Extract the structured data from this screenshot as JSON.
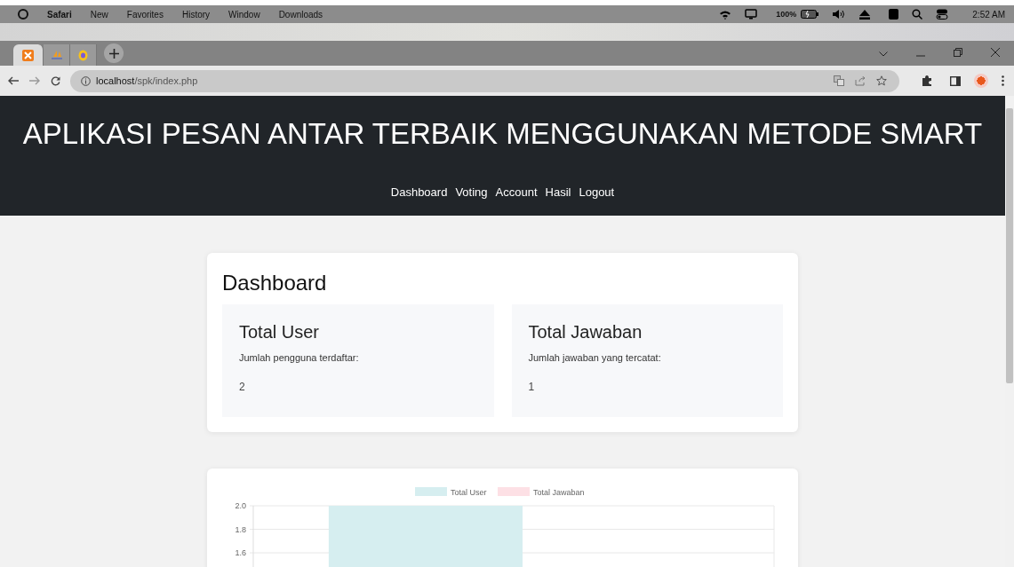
{
  "menubar": {
    "app": "Safari",
    "items": [
      "New",
      "Favorites",
      "History",
      "Window",
      "Downloads"
    ],
    "battery": "100%",
    "time": "2:52 AM"
  },
  "tabs": [
    {
      "kind": "xampp",
      "selected": true
    },
    {
      "kind": "pma",
      "selected": false
    },
    {
      "kind": "globe",
      "selected": false
    }
  ],
  "address": {
    "host": "localhost",
    "path": "/spk/index.php"
  },
  "header": {
    "title": "APLIKASI PESAN ANTAR TERBAIK MENGGUNAKAN METODE SMART",
    "nav": [
      "Dashboard",
      "Voting",
      "Account",
      "Hasil",
      "Logout"
    ]
  },
  "dashboard": {
    "title": "Dashboard",
    "stats": [
      {
        "title": "Total User",
        "subtitle": "Jumlah pengguna terdaftar:",
        "value": "2"
      },
      {
        "title": "Total Jawaban",
        "subtitle": "Jumlah jawaban yang tercatat:",
        "value": "1"
      }
    ]
  },
  "chart": {
    "chart_data": {
      "type": "bar",
      "categories": [
        null
      ],
      "legend": "top",
      "ylim": [
        0,
        2
      ],
      "series": [
        {
          "name": "Total User",
          "color": "#d6eef0",
          "values": [
            2
          ]
        },
        {
          "name": "Total Jawaban",
          "color": "#fde0e5",
          "values": [
            null
          ]
        }
      ],
      "yticks": [
        {
          "value": 2,
          "label": "2.0"
        },
        {
          "value": 1.8,
          "label": "1.8"
        },
        {
          "value": 1.6,
          "label": "1.6"
        }
      ]
    }
  }
}
